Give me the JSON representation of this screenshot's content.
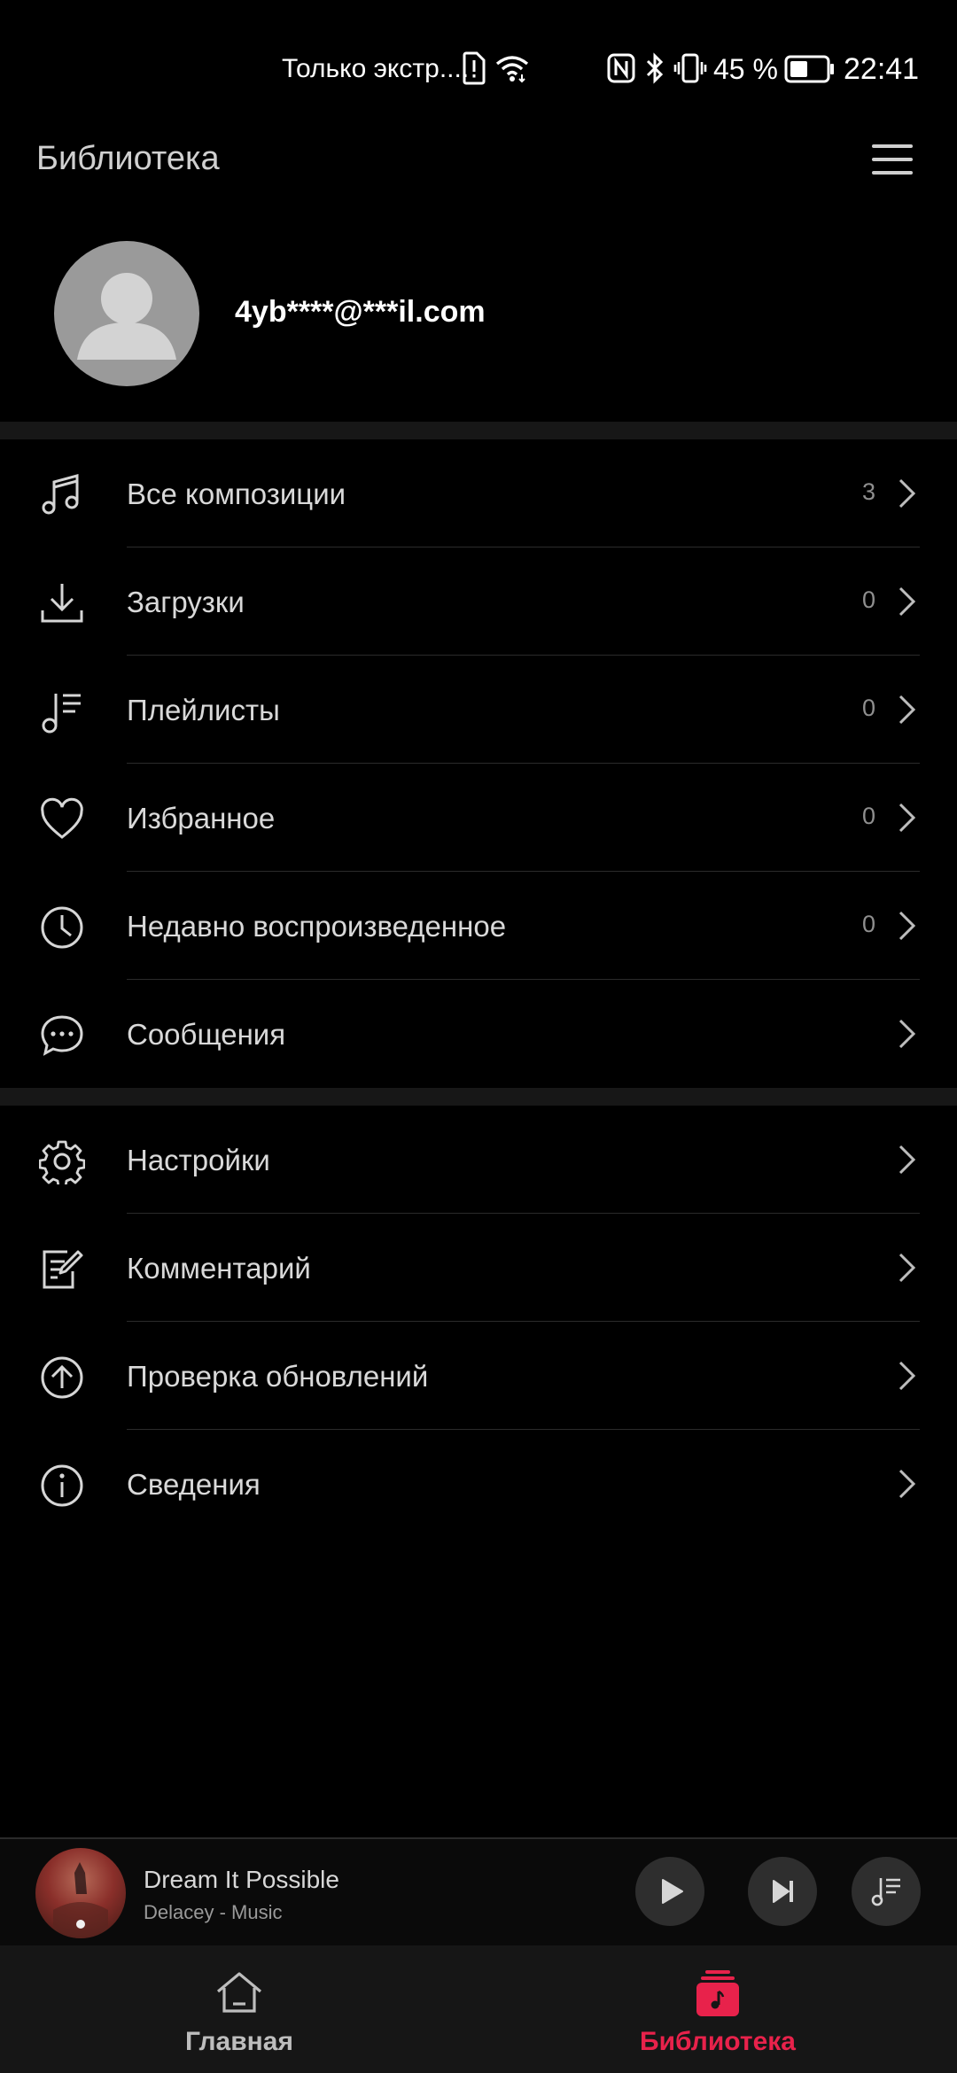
{
  "status_bar": {
    "carrier_text": "Только экстр....",
    "battery": "45 %",
    "time": "22:41"
  },
  "header": {
    "title": "Библиотека"
  },
  "profile": {
    "email": "4yb****@***il.com"
  },
  "library_items": [
    {
      "label": "Все композиции",
      "count": "3",
      "icon": "music-note-icon"
    },
    {
      "label": "Загрузки",
      "count": "0",
      "icon": "download-icon"
    },
    {
      "label": "Плейлисты",
      "count": "0",
      "icon": "playlist-icon"
    },
    {
      "label": "Избранное",
      "count": "0",
      "icon": "heart-icon"
    },
    {
      "label": "Недавно воспроизведенное",
      "count": "0",
      "icon": "clock-icon"
    },
    {
      "label": "Сообщения",
      "icon": "chat-bubble-icon"
    }
  ],
  "settings_items": [
    {
      "label": "Настройки",
      "icon": "gear-icon"
    },
    {
      "label": "Комментарий",
      "icon": "edit-note-icon"
    },
    {
      "label": "Проверка обновлений",
      "icon": "arrow-up-circle-icon"
    },
    {
      "label": "Сведения",
      "icon": "info-icon"
    }
  ],
  "now_playing": {
    "title": "Dream It Possible",
    "artist": "Delacey - Music"
  },
  "bottom_nav": {
    "home_label": "Главная",
    "library_label": "Библиотека",
    "active_color": "#e8224b"
  }
}
